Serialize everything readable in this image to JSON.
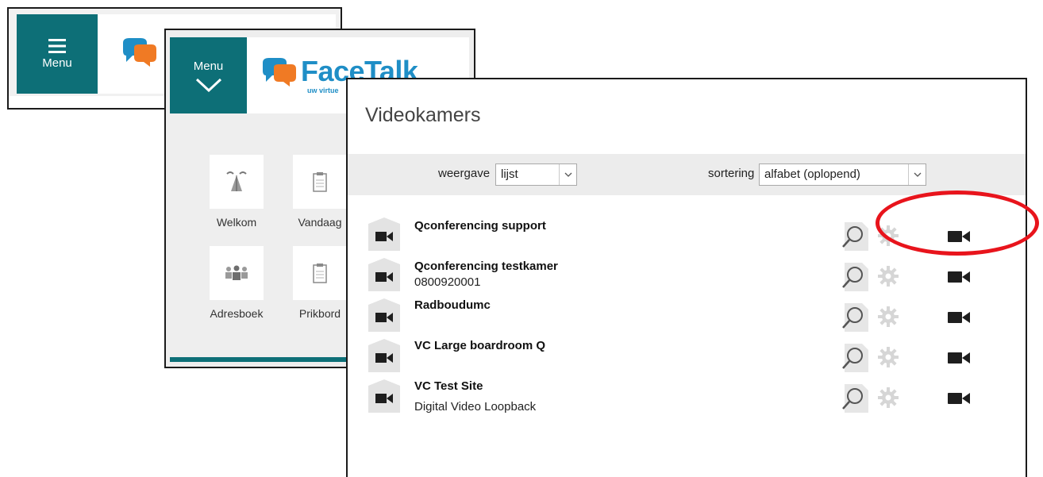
{
  "window_back": {
    "menu_label": "Menu"
  },
  "window_middle": {
    "menu_label": "Menu",
    "brand_word": "FaceTalk",
    "brand_tagline": "uw virtue",
    "tiles": [
      {
        "label": "Welkom",
        "icon": "welcome-icon"
      },
      {
        "label": "Vandaag",
        "icon": "clipboard-icon"
      },
      {
        "label": "Adresboek",
        "icon": "address-book-icon"
      },
      {
        "label": "Prikbord",
        "icon": "clipboard-icon"
      }
    ]
  },
  "videokamers": {
    "title": "Videokamers",
    "view_label": "weergave",
    "view_value": "lijst",
    "sort_label": "sortering",
    "sort_value": "alfabet (oplopend)",
    "rooms": [
      {
        "name": "Qconferencing support",
        "sub": ""
      },
      {
        "name": "Qconferencing testkamer",
        "sub": "0800920001"
      },
      {
        "name": "Radboudumc",
        "sub": ""
      },
      {
        "name": "VC Large boardroom Q",
        "sub": ""
      },
      {
        "name": "VC Test Site",
        "sub": "Digital Video Loopback"
      }
    ]
  },
  "colors": {
    "teal": "#0d6f77",
    "brand_blue": "#1f8ec6",
    "brand_orange": "#f07a24",
    "highlight_red": "#e8141c"
  }
}
